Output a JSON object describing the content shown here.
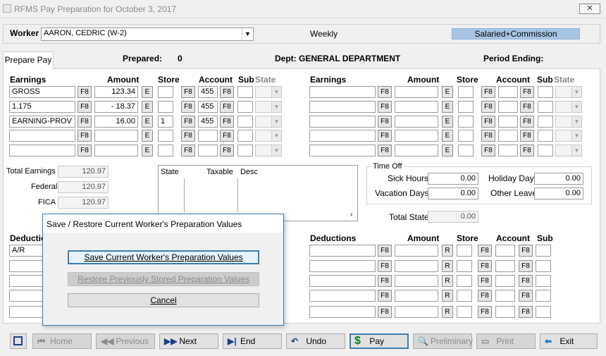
{
  "window": {
    "title": "RFMS Pay Preparation for October  3, 2017",
    "close": "✕"
  },
  "worker": {
    "label": "Worker",
    "value": "AARON, CEDRIC (W-2)",
    "frequency": "Weekly",
    "pay_type": "Salaried+Commission"
  },
  "tab": {
    "label": "Prepare Pay"
  },
  "header": {
    "prepared_label": "Prepared:",
    "prepared_value": "0",
    "dept": "Dept: GENERAL DEPARTMENT",
    "period_label": "Period Ending:"
  },
  "earnings_cols": {
    "earnings": "Earnings",
    "amount": "Amount",
    "store": "Store",
    "account": "Account",
    "sub": "Sub",
    "state": "State"
  },
  "earnings_left": [
    {
      "name": "GROSS",
      "amount": "123.34",
      "store": "",
      "account": "455"
    },
    {
      "name": "1.175",
      "amount": "-   18.37",
      "store": "",
      "account": "455"
    },
    {
      "name": "EARNING-PROV",
      "amount": "16.00",
      "store": "1",
      "account": "455"
    },
    {
      "name": "",
      "amount": "",
      "store": "",
      "account": ""
    },
    {
      "name": "",
      "amount": "",
      "store": "",
      "account": ""
    }
  ],
  "buttons": {
    "f8": "F8",
    "e": "E",
    "r": "R"
  },
  "totals": {
    "total_earnings_label": "Total Earnings",
    "total_earnings": "120.97",
    "federal_label": "Federal",
    "federal": "120.97",
    "fica_label": "FICA",
    "fica": "120.97"
  },
  "state_table": {
    "state": "State",
    "taxable": "Taxable",
    "desc": "Desc"
  },
  "time_off": {
    "legend": "Time Off",
    "sick_label": "Sick Hours",
    "sick": "0.00",
    "holiday_label": "Holiday Days",
    "holiday": "0.00",
    "vacation_label": "Vacation Days",
    "vacation": "0.00",
    "other_label": "Other Leave",
    "other": "0.00"
  },
  "total_state": {
    "label": "Total State",
    "value": "0.00"
  },
  "deductions_cols": {
    "deductions": "Deductions",
    "amount": "Amount",
    "store": "Store",
    "account": "Account",
    "sub": "Sub"
  },
  "deductions_left": [
    {
      "name": "A/R"
    },
    {
      "name": ""
    },
    {
      "name": ""
    },
    {
      "name": ""
    },
    {
      "name": ""
    }
  ],
  "dialog": {
    "title": "Save / Restore Current Worker's Preparation Values",
    "save": "Save Current Worker's Preparation Values",
    "restore": "Restore Previously Stored Preparation Values",
    "cancel": "Cancel"
  },
  "toolbar": {
    "home": "Home",
    "previous": "Previous",
    "next": "Next",
    "end": "End",
    "undo": "Undo",
    "pay": "Pay",
    "preliminary": "Preliminary",
    "print": "Print",
    "exit": "Exit"
  }
}
